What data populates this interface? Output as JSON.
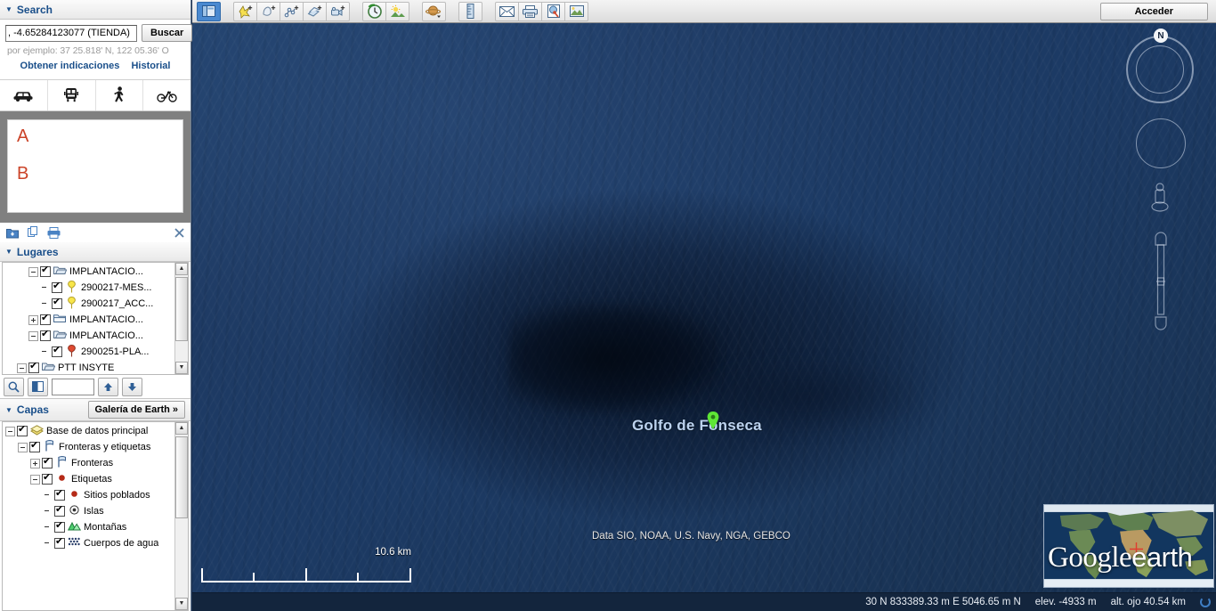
{
  "search_panel": {
    "title": "Search",
    "input_value": ", -4.65284123077 (TIENDA)",
    "search_button": "Buscar",
    "hint": "por ejemplo: 37 25.818' N, 122 05.36' O",
    "directions_link": "Obtener indicaciones",
    "history_link": "Historial",
    "travel_modes": [
      {
        "name": "car-mode",
        "icon": "car-icon"
      },
      {
        "name": "transit-mode",
        "icon": "train-icon"
      },
      {
        "name": "walk-mode",
        "icon": "walk-icon"
      },
      {
        "name": "bike-mode",
        "icon": "bike-icon"
      }
    ],
    "directions": {
      "from_label": "A",
      "to_label": "B"
    }
  },
  "places_panel": {
    "title": "Lugares",
    "toolbar_icons": [
      "import-icon",
      "copy-icon",
      "print-icon",
      "close-icon"
    ],
    "items": [
      {
        "indent": 2,
        "expander": "minus",
        "checked": true,
        "icon": "folder-open-icon",
        "label": "IMPLANTACIO..."
      },
      {
        "indent": 3,
        "expander": "none",
        "checked": true,
        "icon": "yellow-pin-icon",
        "label": "2900217-MES..."
      },
      {
        "indent": 3,
        "expander": "none",
        "checked": true,
        "icon": "yellow-pin-icon",
        "label": "2900217_ACC..."
      },
      {
        "indent": 2,
        "expander": "plus",
        "checked": true,
        "icon": "folder-closed-icon",
        "label": "IMPLANTACIO..."
      },
      {
        "indent": 2,
        "expander": "minus",
        "checked": true,
        "icon": "folder-open-icon",
        "label": "IMPLANTACIO..."
      },
      {
        "indent": 3,
        "expander": "none",
        "checked": true,
        "icon": "red-pin-icon",
        "label": "2900251-PLA..."
      },
      {
        "indent": 1,
        "expander": "minus",
        "checked": true,
        "icon": "folder-open-icon",
        "label": "PTT INSYTE"
      }
    ],
    "find_value": "",
    "buttons": [
      "search-places-icon",
      "view-toggle-icon",
      "move-up-icon",
      "move-down-icon"
    ]
  },
  "layers_panel": {
    "title": "Capas",
    "gallery_button": "Galería de Earth",
    "gallery_chevron": "»",
    "items": [
      {
        "indent": 0,
        "expander": "minus",
        "checked": true,
        "icon": "layers-icon",
        "label": "Base de datos principal"
      },
      {
        "indent": 1,
        "expander": "minus",
        "checked": true,
        "icon": "flag-icon",
        "label": "Fronteras y etiquetas"
      },
      {
        "indent": 2,
        "expander": "plus",
        "checked": true,
        "icon": "flag-icon",
        "label": "Fronteras"
      },
      {
        "indent": 2,
        "expander": "minus",
        "checked": true,
        "icon": "red-dot-icon",
        "label": "Etiquetas"
      },
      {
        "indent": 3,
        "expander": "none",
        "checked": true,
        "icon": "red-dot-icon",
        "label": "Sitios poblados"
      },
      {
        "indent": 3,
        "expander": "none",
        "checked": true,
        "icon": "island-icon",
        "label": "Islas"
      },
      {
        "indent": 3,
        "expander": "none",
        "checked": true,
        "icon": "mountain-icon",
        "label": "Montañas"
      },
      {
        "indent": 3,
        "expander": "none",
        "checked": true,
        "icon": "water-icon",
        "label": "Cuerpos de agua"
      }
    ]
  },
  "toolbar": {
    "groups": [
      {
        "buttons": [
          {
            "name": "toggle-sidebar-button",
            "icon": "sidebar-panel-icon",
            "active": true
          }
        ]
      },
      {
        "buttons": [
          {
            "name": "add-placemark-button",
            "icon": "placemark-plus-icon",
            "active": false
          },
          {
            "name": "add-polygon-button",
            "icon": "polygon-plus-icon",
            "active": false
          },
          {
            "name": "add-path-button",
            "icon": "path-plus-icon",
            "active": false
          },
          {
            "name": "add-image-overlay-button",
            "icon": "overlay-plus-icon",
            "active": false
          },
          {
            "name": "record-tour-button",
            "icon": "camera-plus-icon",
            "active": false
          }
        ]
      },
      {
        "buttons": [
          {
            "name": "historical-imagery-button",
            "icon": "clock-icon",
            "active": false
          },
          {
            "name": "sunlight-button",
            "icon": "sun-icon",
            "active": false
          }
        ]
      },
      {
        "buttons": [
          {
            "name": "planet-switcher-button",
            "icon": "planet-icon",
            "active": false
          }
        ]
      },
      {
        "buttons": [
          {
            "name": "ruler-button",
            "icon": "ruler-icon",
            "active": false
          }
        ]
      },
      {
        "buttons": [
          {
            "name": "email-button",
            "icon": "envelope-icon",
            "active": false
          },
          {
            "name": "print-button",
            "icon": "printer-icon",
            "active": false
          },
          {
            "name": "view-in-maps-button",
            "icon": "globe-page-icon",
            "active": false
          },
          {
            "name": "save-image-button",
            "icon": "image-icon",
            "active": false
          }
        ]
      }
    ],
    "sign_in_button": "Acceder"
  },
  "map": {
    "feature_label": "Golfo de Fonseca",
    "attribution": "Data SIO, NOAA, U.S. Navy, NGA, GEBCO",
    "scale_text": "10.6 km",
    "north_badge": "N"
  },
  "overview": {
    "logo_google": "Google",
    "logo_earth": "earth"
  },
  "status_bar": {
    "coordinates": "30 N 833389.33 m E 5046.65 m N",
    "elevation": "elev. -4933 m",
    "eye_altitude": "alt. ojo  40.54 km"
  },
  "colors": {
    "accent_blue": "#1a4f8a",
    "ab_red": "#cb4328",
    "ocean_dark": "#17304f",
    "ocean_light": "#23436e",
    "label_blue": "#bcd2ee",
    "placemark_green": "#5ee636"
  }
}
